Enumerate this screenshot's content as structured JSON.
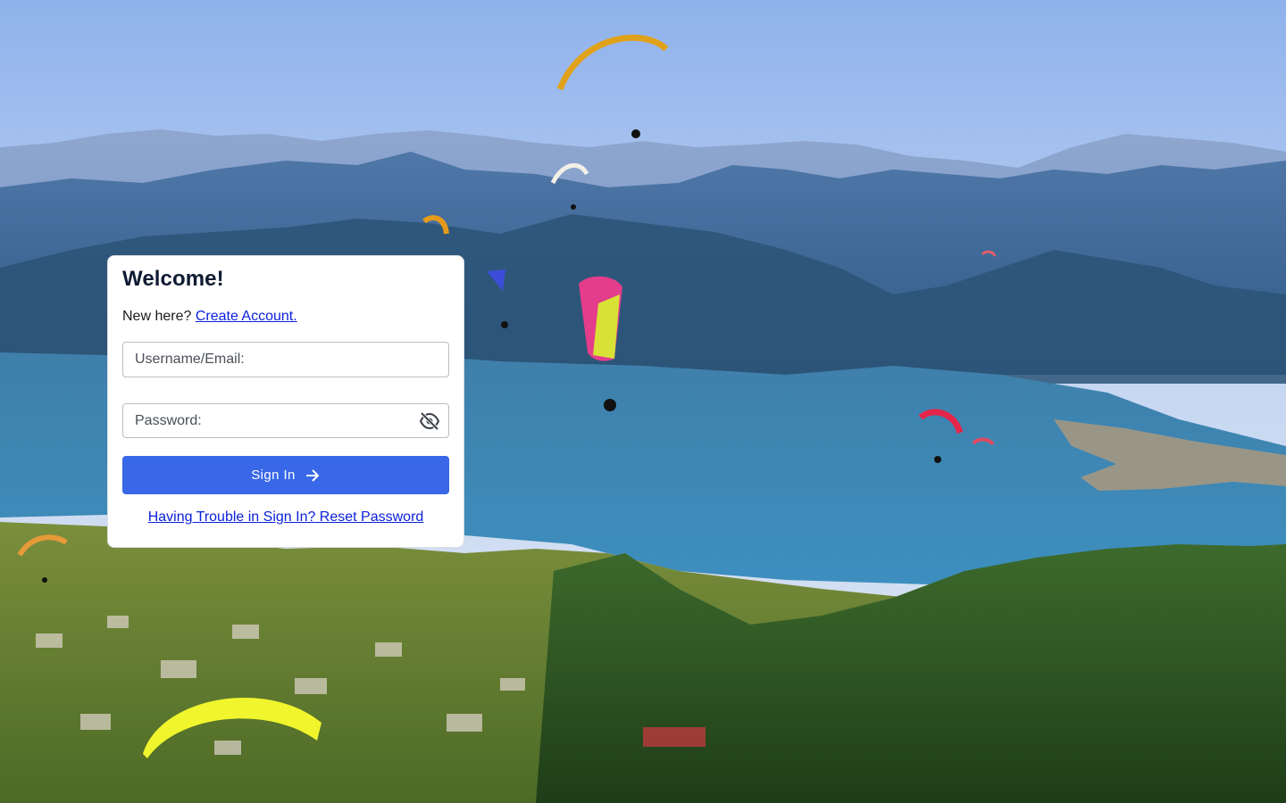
{
  "background": {
    "description_icon": "paraglider-lake-landscape"
  },
  "login": {
    "title": "Welcome!",
    "new_here_text": "New here?",
    "create_account_link": "Create Account.",
    "username_placeholder": "Username/Email:",
    "username_value": "",
    "password_placeholder": "Password:",
    "password_value": "",
    "password_toggle_icon": "eye-off-icon",
    "sign_in_label": "Sign In",
    "sign_in_icon": "arrow-right-icon",
    "reset_link": "Having Trouble in Sign In? Reset Password"
  },
  "colors": {
    "accent": "#3868e8",
    "link": "#0b21d9",
    "title": "#0f1b33"
  }
}
